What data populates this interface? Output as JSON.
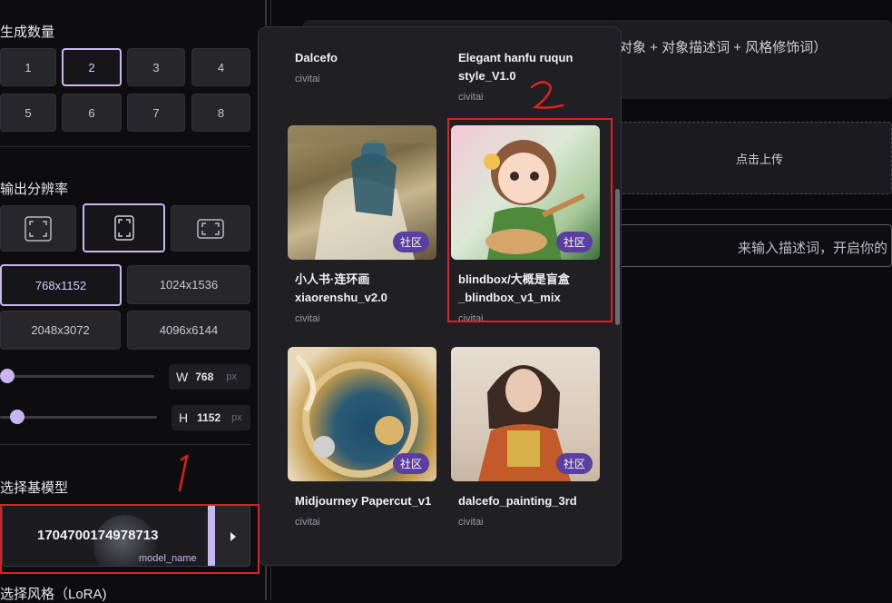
{
  "left": {
    "count_title": "生成数量",
    "counts": [
      "1",
      "2",
      "3",
      "4",
      "5",
      "6",
      "7",
      "8"
    ],
    "count_selected": "2",
    "resolution_title": "输出分辨率",
    "resolutions": [
      "768x1152",
      "1024x1536",
      "2048x3072",
      "4096x6144"
    ],
    "resolution_selected": "768x1152",
    "width_label": "W",
    "width_value": "768",
    "height_label": "H",
    "height_value": "1152",
    "unit": "px",
    "base_model_title": "选择基模型",
    "base_model_name": "1704700174978713",
    "base_model_sub": "model_name",
    "lora_title": "选择风格（LoRA)"
  },
  "main": {
    "prompt_hint": "对象 + 对象描述词 + 风格修饰词）",
    "upload_label": "点击上传",
    "desc_hint": "来输入描述词，开启你的"
  },
  "popup": {
    "items": [
      {
        "name": "Dalcefo",
        "source": "civitai"
      },
      {
        "name": "Elegant hanfu ruqun style_V1.0",
        "source": "civitai"
      },
      {
        "name": "小人书·连环画 xiaorenshu_v2.0",
        "source": "civitai",
        "badge": "社区"
      },
      {
        "name": "blindbox/大概是盲盒 _blindbox_v1_mix",
        "source": "civitai",
        "badge": "社区"
      },
      {
        "name": "Midjourney Papercut_v1",
        "source": "civitai",
        "badge": "社区"
      },
      {
        "name": "dalcefo_painting_3rd",
        "source": "civitai",
        "badge": "社区"
      }
    ]
  },
  "annotations": {
    "mark1": "1",
    "mark2": "2"
  },
  "colors": {
    "accent": "#c9b8f0",
    "badge": "#5b3fa0",
    "annotation": "#e0201c"
  }
}
